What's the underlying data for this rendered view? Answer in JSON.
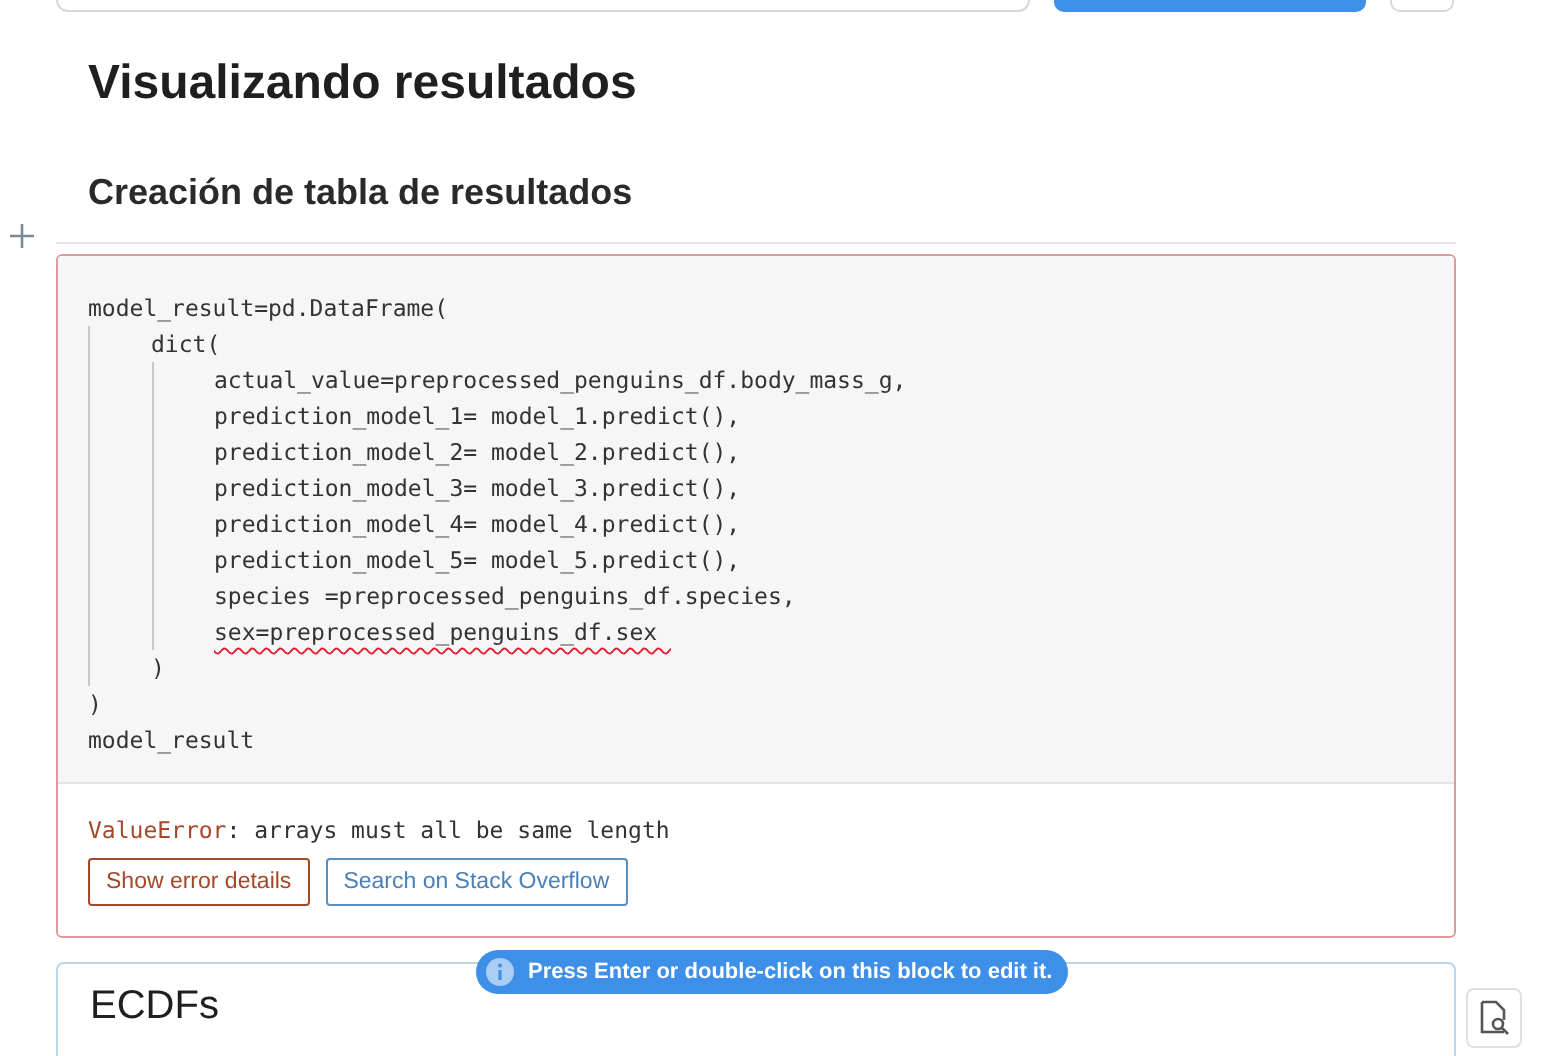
{
  "heading": "Visualizando resultados",
  "subheading": "Creación de tabla de resultados",
  "code_cell": {
    "lines": [
      {
        "text": "model_result=pd.DataFrame(",
        "spell_error": false
      },
      {
        "text": "    dict(",
        "spell_error": false
      },
      {
        "text": "        actual_value=preprocessed_penguins_df.body_mass_g,",
        "spell_error": false
      },
      {
        "text": "        prediction_model_1= model_1.predict(),",
        "spell_error": false
      },
      {
        "text": "        prediction_model_2= model_2.predict(),",
        "spell_error": false
      },
      {
        "text": "        prediction_model_3= model_3.predict(),",
        "spell_error": false
      },
      {
        "text": "        prediction_model_4= model_4.predict(),",
        "spell_error": false
      },
      {
        "text": "        prediction_model_5= model_5.predict(),",
        "spell_error": false
      },
      {
        "text": "        species =preprocessed_penguins_df.species,",
        "spell_error": false
      },
      {
        "text": "        sex=preprocessed_penguins_df.sex ",
        "spell_error": true
      },
      {
        "text": "    )",
        "spell_error": false
      },
      {
        "text": ")",
        "spell_error": false
      },
      {
        "text": "model_result",
        "spell_error": false
      }
    ],
    "error": {
      "type": "ValueError",
      "message": ": arrays must all be same length"
    },
    "buttons": [
      {
        "label": "Show error details",
        "kind": "error"
      },
      {
        "label": "Search on Stack Overflow",
        "kind": "search"
      }
    ]
  },
  "tooltip": "Press Enter or double-click on this block to edit it.",
  "next_cell": {
    "title": "ECDFs"
  }
}
